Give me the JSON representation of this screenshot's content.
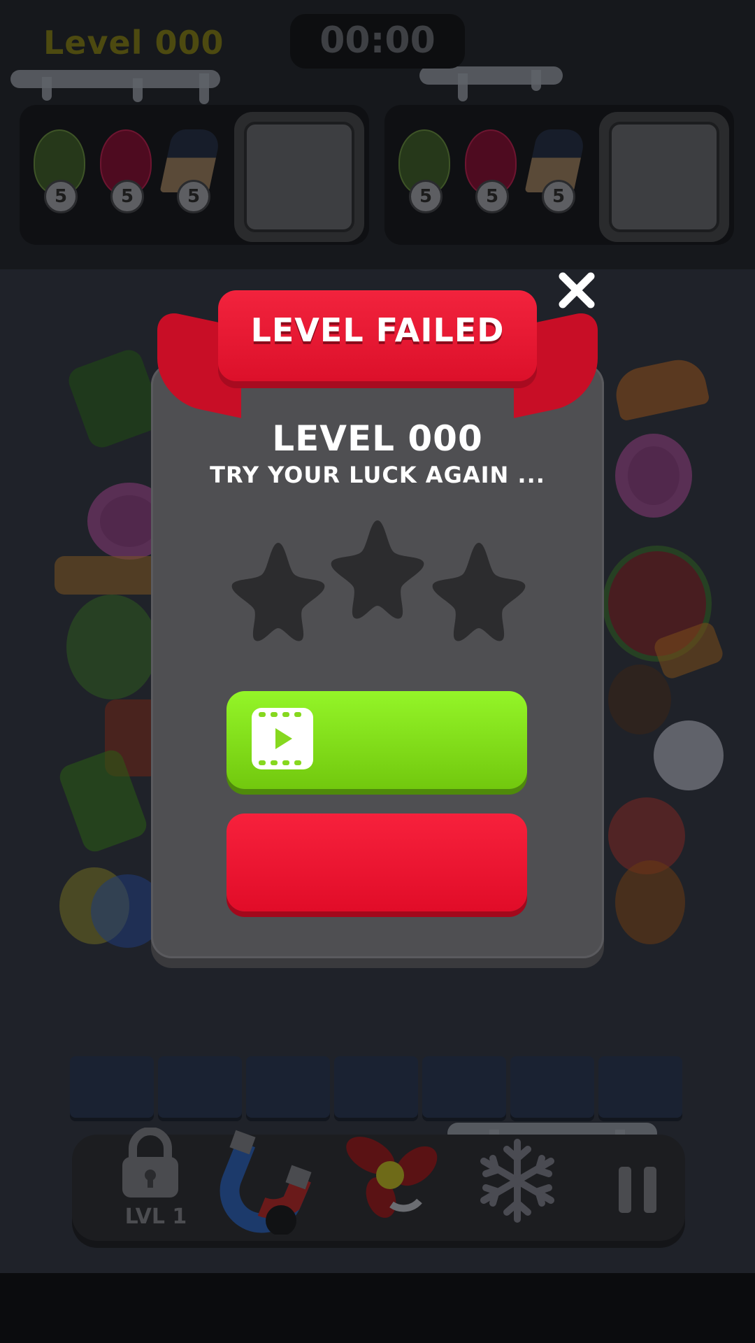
{
  "hud": {
    "level_label": "Level 000",
    "timer": "00:00"
  },
  "goals": [
    {
      "items": [
        {
          "icon": "leaf-icon",
          "count": "5",
          "color": "#2f4a1d"
        },
        {
          "icon": "beet-icon",
          "count": "5",
          "color": "#5a0d24"
        },
        {
          "icon": "cake-slice-icon",
          "count": "5",
          "color": "#3a3f4a"
        }
      ]
    },
    {
      "items": [
        {
          "icon": "leaf-icon",
          "count": "5",
          "color": "#2f4a1d"
        },
        {
          "icon": "beet-icon",
          "count": "5",
          "color": "#5a0d24"
        },
        {
          "icon": "cake-slice-icon",
          "count": "5",
          "color": "#3a3f4a"
        }
      ]
    }
  ],
  "modal": {
    "title": "LEVEL FAILED",
    "level_name": "LEVEL 000",
    "subtitle": "TRY YOUR LUCK AGAIN ...",
    "stars_earned": 0,
    "stars_total": 3,
    "ad_button_label": "",
    "retry_button_label": "",
    "colors": {
      "ribbon": "#e8162f",
      "ad_button": "#85e01c",
      "retry_button": "#ec1331",
      "card": "#4f4f52"
    }
  },
  "boosters": {
    "lock_label": "LVL 1",
    "items": [
      "lock-icon",
      "magnet-icon",
      "fan-icon",
      "snowflake-icon",
      "pause-icon"
    ]
  }
}
